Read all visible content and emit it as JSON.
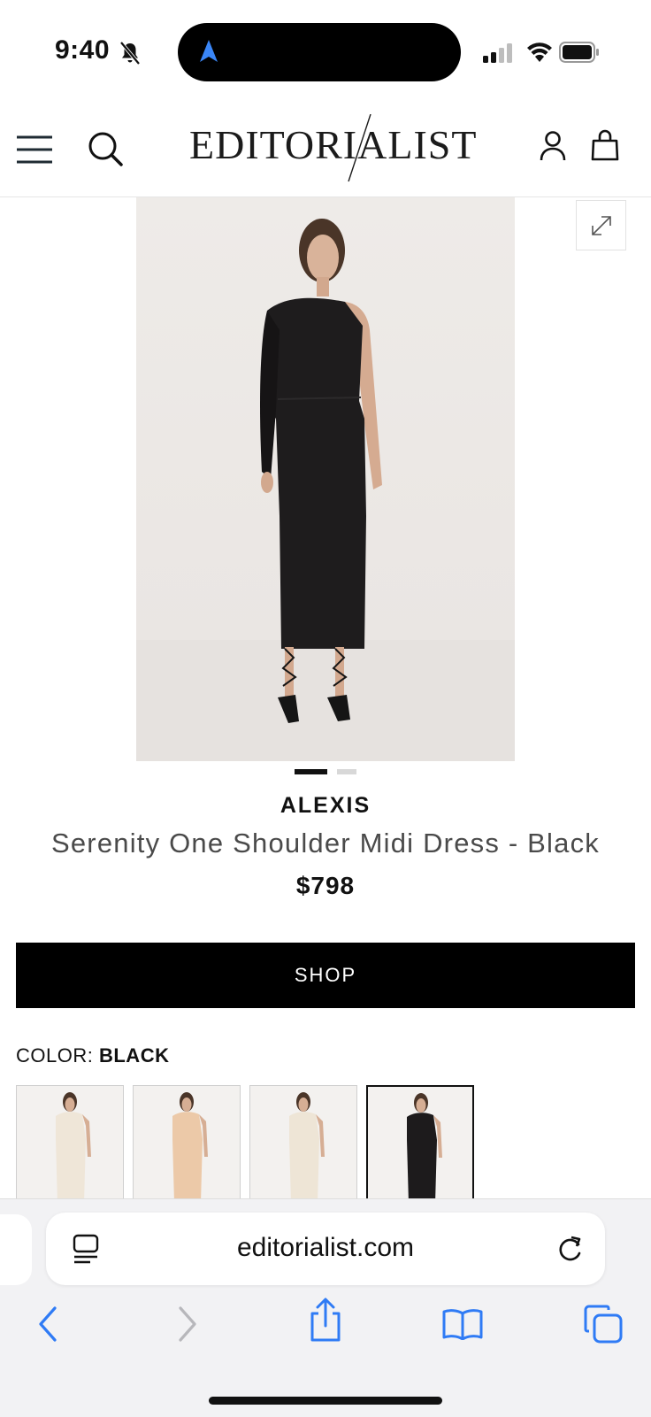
{
  "status_bar": {
    "time": "9:40"
  },
  "header": {
    "logo": "EDITORIALIST"
  },
  "gallery": {
    "dots_total": 2,
    "active_dot": 1
  },
  "product": {
    "brand": "ALEXIS",
    "title": "Serenity One Shoulder Midi Dress - Black",
    "price": "$798",
    "shop_label": "SHOP",
    "color_label": "COLOR:",
    "color_value": "BLACK",
    "swatches": [
      {
        "color": "ivory",
        "hex": "#efe6d8"
      },
      {
        "color": "tan",
        "hex": "#ecc9a8"
      },
      {
        "color": "cream",
        "hex": "#eee5d6"
      },
      {
        "color": "black",
        "hex": "#1d1b1c",
        "selected": true
      }
    ]
  },
  "browser": {
    "url": "editorialist.com",
    "toolbar": [
      "back-icon",
      "forward-icon",
      "share-icon",
      "bookmarks-icon",
      "tabs-icon"
    ]
  },
  "colors": {
    "accent_blue": "#2f7bf5",
    "shop_button": "#000000"
  }
}
